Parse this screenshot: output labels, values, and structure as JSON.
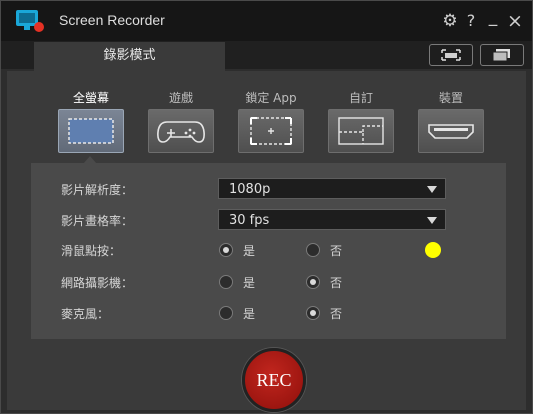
{
  "window": {
    "title": "Screen Recorder"
  },
  "titlebar": {
    "help": "?",
    "minimize": "_",
    "close": "×"
  },
  "tabs": [
    {
      "label": "錄影模式",
      "active": true
    }
  ],
  "modes": [
    {
      "label": "全螢幕",
      "icon": "fullscreen-icon",
      "active": true
    },
    {
      "label": "遊戲",
      "icon": "gamepad-icon",
      "active": false
    },
    {
      "label": "鎖定 App",
      "icon": "lock-app-icon",
      "active": false
    },
    {
      "label": "自訂",
      "icon": "custom-area-icon",
      "active": false
    },
    {
      "label": "裝置",
      "icon": "hdmi-device-icon",
      "active": false
    }
  ],
  "settings": {
    "resolution": {
      "label": "影片解析度：",
      "value": "1080p"
    },
    "framerate": {
      "label": "影片畫格率：",
      "value": "30 fps"
    },
    "mouse_click": {
      "label": "滑鼠點按：",
      "yes": "是",
      "no": "否",
      "selected": "yes",
      "highlight_color": "#ffff00"
    },
    "webcam": {
      "label": "網路攝影機：",
      "yes": "是",
      "no": "否",
      "selected": "no"
    },
    "microphone": {
      "label": "麥克風：",
      "yes": "是",
      "no": "否",
      "selected": "no"
    }
  },
  "rec_button": {
    "label": "REC",
    "color": "#b01a14"
  }
}
